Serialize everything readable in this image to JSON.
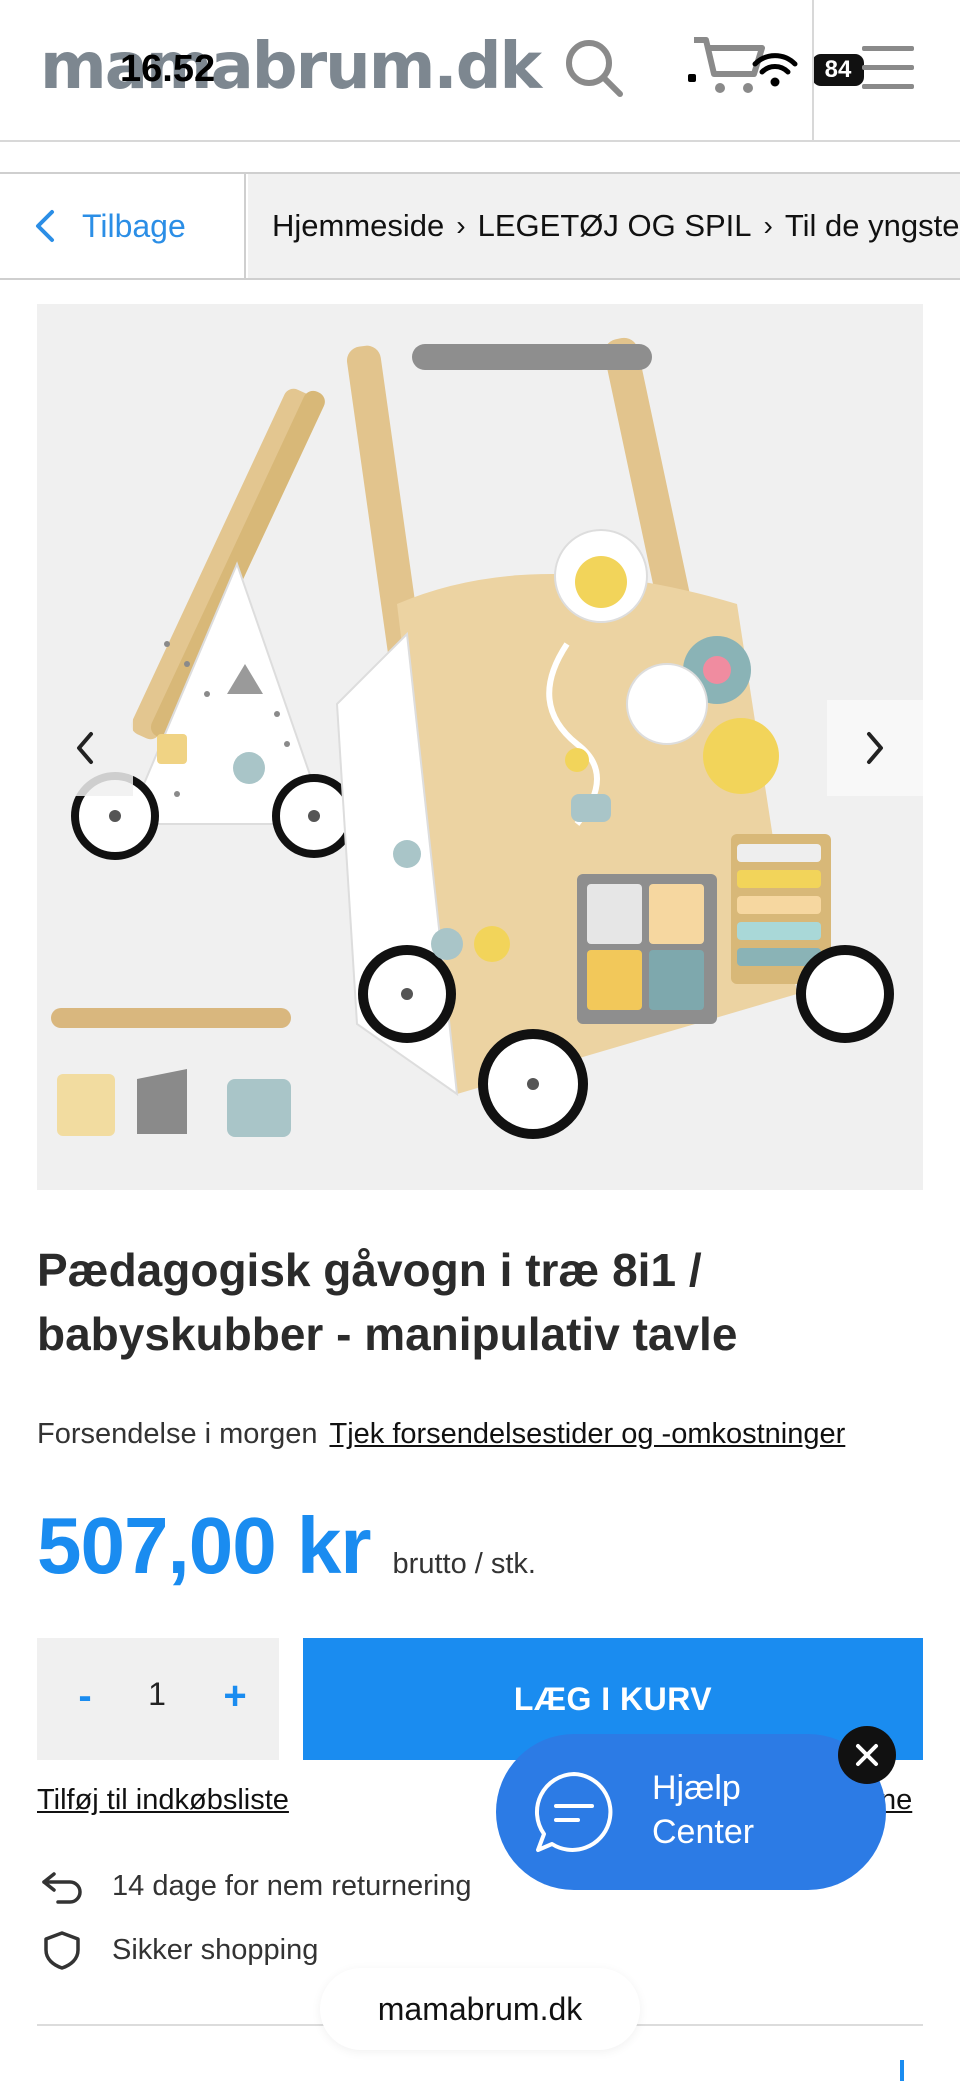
{
  "status": {
    "time": "16.52",
    "battery": "84"
  },
  "header": {
    "logo": "mamabrum.dk"
  },
  "nav": {
    "back_label": "Tilbage",
    "breadcrumbs": [
      "Hjemmeside",
      "LEGETØJ OG SPIL",
      "Til de yngste"
    ]
  },
  "product": {
    "title_line1": "Pædagogisk gåvogn i træ 8i1 /",
    "title_line2": "babyskubber - manipulativ tavle",
    "shipping_text": "Forsendelse i morgen",
    "shipping_link": "Tjek forsendelsestider og -omkostninger",
    "price": "507,00 kr",
    "price_unit": "brutto / stk.",
    "quantity": "1",
    "qty_minus": "-",
    "qty_plus": "+",
    "add_to_cart": "LÆG I KURV",
    "wishlist": "Tilføj til indkøbsliste",
    "compare_fragment": "ne"
  },
  "features": [
    {
      "icon": "return-arrow-icon",
      "text": "14 dage for nem returnering"
    },
    {
      "icon": "shield-icon",
      "text": "Sikker shopping"
    }
  ],
  "help": {
    "line1": "Hjælp",
    "line2": "Center"
  },
  "browser": {
    "url": "mamabrum.dk"
  },
  "colors": {
    "accent": "#1a8cf0",
    "help_bg": "#2c7be5"
  }
}
